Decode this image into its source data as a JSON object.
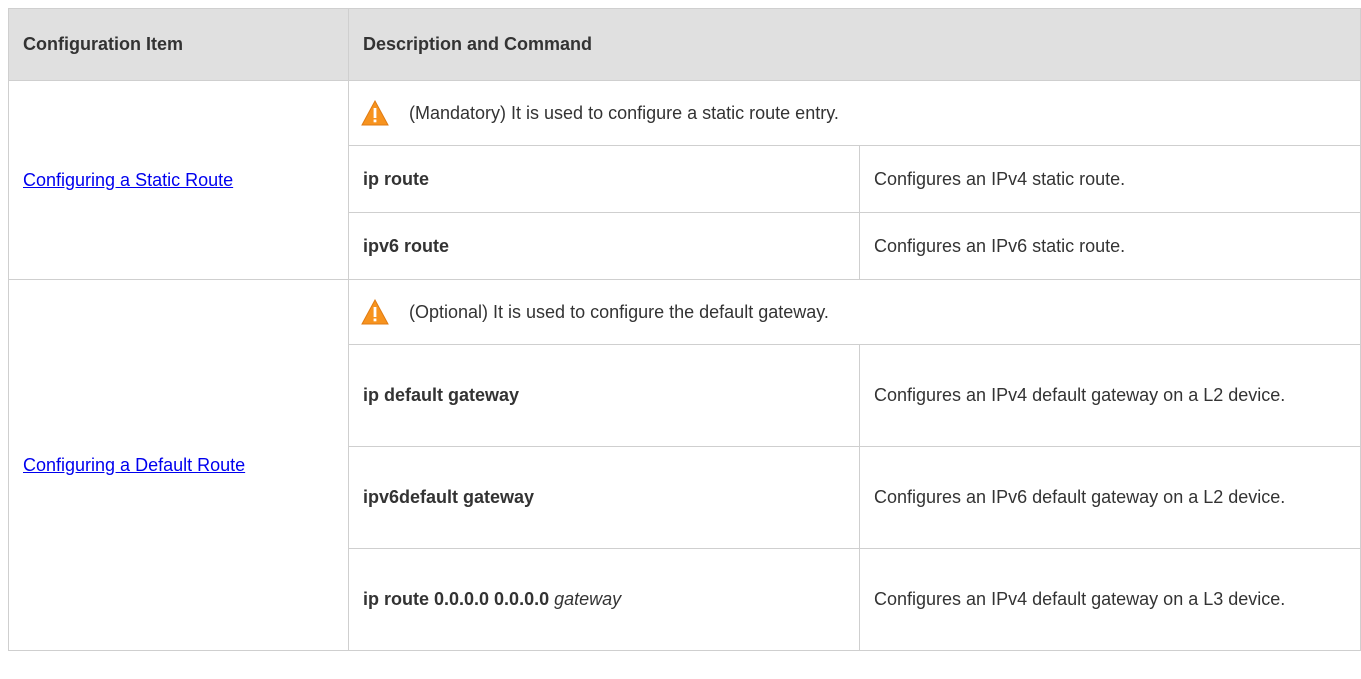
{
  "header": {
    "col1": "Configuration Item",
    "col2": "Description and Command"
  },
  "sections": [
    {
      "item_label": "Configuring a Static Route",
      "note": "(Mandatory) It is used to configure a static route entry.",
      "rows": [
        {
          "command": "ip route",
          "arg": "",
          "description": "Configures an IPv4 static route."
        },
        {
          "command": "ipv6 route",
          "arg": "",
          "description": "Configures an IPv6 static route."
        }
      ]
    },
    {
      "item_label": "Configuring a Default Route",
      "note": "(Optional) It is used to configure the default gateway.",
      "rows": [
        {
          "command": "ip default gateway",
          "arg": "",
          "description": "Configures an IPv4 default gateway on a L2 device."
        },
        {
          "command": "ipv6default gateway",
          "arg": "",
          "description": "Configures an IPv6 default gateway on a L2 device."
        },
        {
          "command": "ip route 0.0.0.0 0.0.0.0",
          "arg": "gateway",
          "description": "Configures an IPv4 default gateway on a L3 device."
        }
      ]
    }
  ],
  "icons": {
    "warning": "warning-triangle-icon",
    "warning_color": "#f7931e"
  },
  "colors": {
    "header_bg": "#e0e0e0",
    "link": "#0000ee",
    "border": "#cfcfcf"
  }
}
